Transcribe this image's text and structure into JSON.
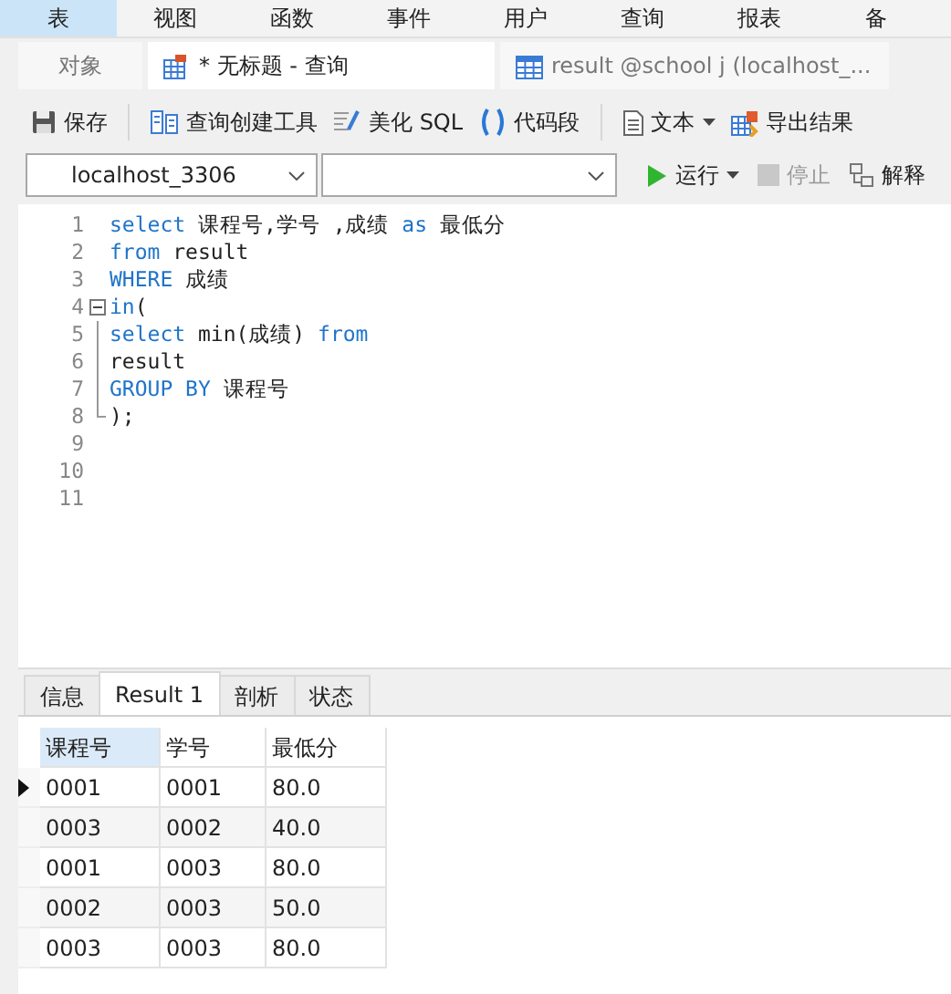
{
  "menu": [
    {
      "label": "表",
      "selected": true
    },
    {
      "label": "视图",
      "selected": false
    },
    {
      "label": "函数",
      "selected": false
    },
    {
      "label": "事件",
      "selected": false
    },
    {
      "label": "用户",
      "selected": false
    },
    {
      "label": "查询",
      "selected": false
    },
    {
      "label": "报表",
      "selected": false
    },
    {
      "label": "备",
      "selected": false
    }
  ],
  "doc_tabs": [
    {
      "label": "对象",
      "kind": "plain",
      "selected": false
    },
    {
      "label": "* 无标题 - 查询",
      "kind": "query",
      "selected": true
    },
    {
      "label": "result @school j (localhost_...",
      "kind": "table",
      "selected": false
    }
  ],
  "toolbar": [
    {
      "label": "保存",
      "kind": "save"
    },
    {
      "label": "查询创建工具",
      "kind": "builder"
    },
    {
      "label": "美化 SQL",
      "kind": "beautify"
    },
    {
      "label": "代码段",
      "kind": "snippet"
    },
    {
      "label": "文本",
      "kind": "text"
    },
    {
      "label": "导出结果",
      "kind": "export"
    }
  ],
  "connection": {
    "value": "localhost_3306"
  },
  "run_buttons": [
    {
      "label": "运行",
      "kind": "run",
      "disabled": false
    },
    {
      "label": "停止",
      "kind": "stop",
      "disabled": true
    },
    {
      "label": "解释",
      "kind": "explain",
      "disabled": false
    }
  ],
  "editor": {
    "lines": [
      {
        "number": "1",
        "kind": "code",
        "tokens": [
          {
            "text": "select",
            "kind": "keyword"
          },
          {
            "text": " 课程号,学号 ,成绩 ",
            "kind": "plain"
          },
          {
            "text": "as",
            "kind": "keyword"
          },
          {
            "text": " 最低分",
            "kind": "plain"
          }
        ]
      },
      {
        "number": "2",
        "kind": "code",
        "tokens": [
          {
            "text": "from",
            "kind": "keyword"
          },
          {
            "text": " result",
            "kind": "plain"
          }
        ]
      },
      {
        "number": "3",
        "kind": "code",
        "tokens": [
          {
            "text": "WHERE",
            "kind": "keyword"
          },
          {
            "text": " 成绩",
            "kind": "plain"
          }
        ]
      },
      {
        "number": "4",
        "kind": "fold_start",
        "tokens": [
          {
            "text": "in",
            "kind": "keyword"
          },
          {
            "text": "(",
            "kind": "plain"
          }
        ]
      },
      {
        "number": "5",
        "kind": "fold_body",
        "tokens": [
          {
            "text": "select",
            "kind": "keyword"
          },
          {
            "text": " min(成绩) ",
            "kind": "plain"
          },
          {
            "text": "from",
            "kind": "keyword"
          }
        ]
      },
      {
        "number": "6",
        "kind": "fold_body",
        "tokens": [
          {
            "text": "result",
            "kind": "plain"
          }
        ]
      },
      {
        "number": "7",
        "kind": "fold_body",
        "tokens": [
          {
            "text": "GROUP BY",
            "kind": "keyword"
          },
          {
            "text": " 课程号",
            "kind": "plain"
          }
        ]
      },
      {
        "number": "8",
        "kind": "fold_end",
        "tokens": [
          {
            "text": ");",
            "kind": "plain"
          }
        ]
      },
      {
        "number": "9",
        "kind": "code"
      },
      {
        "number": "10",
        "kind": "code"
      },
      {
        "number": "11",
        "kind": "code"
      }
    ]
  },
  "result_tabs": [
    {
      "label": "信息",
      "selected": false
    },
    {
      "label": "Result 1",
      "selected": true
    },
    {
      "label": "剖析",
      "selected": false
    },
    {
      "label": "状态",
      "selected": false
    }
  ],
  "table": {
    "columns": [
      {
        "label": "课程号",
        "selected": true
      },
      {
        "label": "学号",
        "selected": false
      },
      {
        "label": "最低分",
        "selected": false
      }
    ],
    "rows": [
      {
        "selected": true,
        "cells": [
          "0001",
          "0001",
          "80.0"
        ]
      },
      {
        "selected": false,
        "cells": [
          "0003",
          "0002",
          "40.0"
        ]
      },
      {
        "selected": false,
        "cells": [
          "0001",
          "0003",
          "80.0"
        ]
      },
      {
        "selected": false,
        "cells": [
          "0002",
          "0003",
          "50.0"
        ]
      },
      {
        "selected": false,
        "cells": [
          "0003",
          "0003",
          "80.0"
        ]
      }
    ]
  }
}
